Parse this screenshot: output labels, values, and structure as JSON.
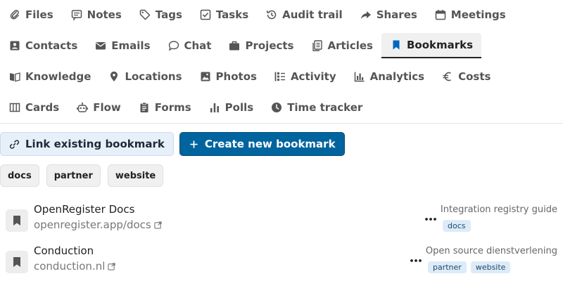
{
  "tabs": {
    "rows": [
      [
        {
          "label": "Files",
          "icon": "paperclip-icon"
        },
        {
          "label": "Notes",
          "icon": "note-icon"
        },
        {
          "label": "Tags",
          "icon": "tag-icon"
        },
        {
          "label": "Tasks",
          "icon": "checkbox-icon"
        },
        {
          "label": "Audit trail",
          "icon": "history-icon"
        },
        {
          "label": "Shares",
          "icon": "share-icon"
        },
        {
          "label": "Meetings",
          "icon": "calendar-icon"
        }
      ],
      [
        {
          "label": "Contacts",
          "icon": "contact-card-icon"
        },
        {
          "label": "Emails",
          "icon": "envelope-icon"
        },
        {
          "label": "Chat",
          "icon": "chat-bubble-icon"
        },
        {
          "label": "Projects",
          "icon": "briefcase-icon"
        },
        {
          "label": "Articles",
          "icon": "document-icon"
        },
        {
          "label": "Bookmarks",
          "icon": "bookmark-icon",
          "active": true
        }
      ],
      [
        {
          "label": "Knowledge",
          "icon": "book-open-icon"
        },
        {
          "label": "Locations",
          "icon": "map-pin-icon"
        },
        {
          "label": "Photos",
          "icon": "image-icon"
        },
        {
          "label": "Activity",
          "icon": "activity-icon"
        },
        {
          "label": "Analytics",
          "icon": "bar-chart-icon"
        },
        {
          "label": "Costs",
          "icon": "euro-icon"
        }
      ],
      [
        {
          "label": "Cards",
          "icon": "columns-icon"
        },
        {
          "label": "Flow",
          "icon": "robot-icon"
        },
        {
          "label": "Forms",
          "icon": "clipboard-icon"
        },
        {
          "label": "Polls",
          "icon": "poll-icon"
        },
        {
          "label": "Time tracker",
          "icon": "clock-icon"
        }
      ]
    ]
  },
  "actions": {
    "link_existing": "Link existing bookmark",
    "create_new": "Create new bookmark",
    "accent": "#00649e"
  },
  "filters": [
    "docs",
    "partner",
    "website"
  ],
  "bookmarks": [
    {
      "title": "OpenRegister Docs",
      "url": "openregister.app/docs",
      "description": "Integration registry guide",
      "tags": [
        "docs"
      ]
    },
    {
      "title": "Conduction",
      "url": "conduction.nl",
      "description": "Open source dienstverlening",
      "tags": [
        "partner",
        "website"
      ]
    }
  ]
}
